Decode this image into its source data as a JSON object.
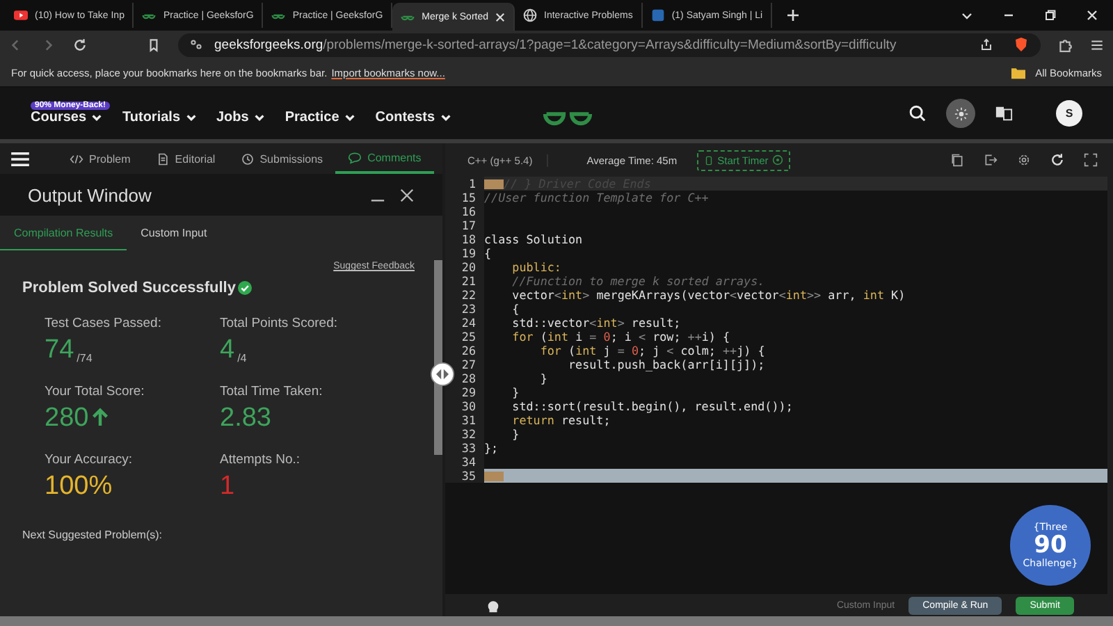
{
  "browser": {
    "tabs": [
      {
        "title": "(10) How to Take Inp",
        "kind": "video",
        "selected": false
      },
      {
        "title": "Practice | GeeksforG",
        "kind": "gfg",
        "selected": false
      },
      {
        "title": "Practice | GeeksforG",
        "kind": "gfg",
        "selected": false
      },
      {
        "title": "Merge k Sorted",
        "kind": "gfg",
        "selected": true
      },
      {
        "title": "Interactive Problems",
        "kind": "globe",
        "selected": false
      },
      {
        "title": "(1) Satyam Singh | Li",
        "kind": "square",
        "selected": false
      }
    ],
    "address": {
      "domain": "geeksforgeeks.org",
      "path": "/problems/merge-k-sorted-arrays/1?page=1&category=Arrays&difficulty=Medium&sortBy=difficulty"
    },
    "bookmarks": {
      "message": "For quick access, place your bookmarks here on the bookmarks bar.",
      "link": "Import bookmarks now...",
      "all": "All Bookmarks"
    }
  },
  "site_nav": {
    "badge": "90% Money-Back!",
    "items": [
      "Courses",
      "Tutorials",
      "Jobs",
      "Practice",
      "Contests"
    ],
    "avatar": "S"
  },
  "problem_tabs": [
    {
      "label": "Problem",
      "kind": "code",
      "selected": false
    },
    {
      "label": "Editorial",
      "kind": "doc",
      "selected": false
    },
    {
      "label": "Submissions",
      "kind": "clock",
      "selected": false
    },
    {
      "label": "Comments",
      "kind": "chat",
      "selected": true
    }
  ],
  "output_window": {
    "title": "Output Window",
    "tabs": [
      {
        "label": "Compilation Results",
        "selected": true
      },
      {
        "label": "Custom Input",
        "selected": false
      }
    ],
    "suggest_feedback": "Suggest Feedback",
    "status": "Problem Solved Successfully",
    "stats": [
      {
        "label": "Test Cases Passed:",
        "value": "74",
        "suffix": "/74",
        "color": "#3ea55c"
      },
      {
        "label": "Total Points Scored:",
        "value": "4",
        "suffix": "/4",
        "color": "#3ea55c"
      },
      {
        "label": "Your Total Score:",
        "value": "280",
        "arrow": true,
        "color": "#3ea55c"
      },
      {
        "label": "Total Time Taken:",
        "value": "2.83",
        "color": "#3ea55c"
      },
      {
        "label": "Your Accuracy:",
        "value": "100%",
        "color": "#e5b52c"
      },
      {
        "label": "Attempts No.:",
        "value": "1",
        "color": "#d42a2a"
      }
    ],
    "next_label": "Next Suggested Problem(s):"
  },
  "editor": {
    "language": "C++ (g++ 5.4)",
    "average_time": "Average Time: 45m",
    "timer": "Start Timer",
    "lines": [
      {
        "number": "1",
        "folded": true,
        "selected": false,
        "segs": [
          {
            "kind": "dim",
            "t": "// } Driver Code Ends"
          }
        ]
      },
      {
        "number": "15",
        "folded": false,
        "selected": false,
        "segs": [
          {
            "kind": "cm",
            "t": "//User function Template for C++"
          }
        ]
      },
      {
        "number": "16",
        "folded": false,
        "selected": false
      },
      {
        "number": "17",
        "folded": false,
        "selected": false
      },
      {
        "number": "18",
        "folded": false,
        "selected": false,
        "segs": [
          {
            "kind": "p",
            "t": "class Solution"
          }
        ]
      },
      {
        "number": "19",
        "folded": false,
        "selected": false,
        "segs": [
          {
            "kind": "p",
            "t": "{"
          }
        ]
      },
      {
        "number": "20",
        "folded": false,
        "selected": false,
        "segs": [
          {
            "kind": "kw",
            "t": "    public:"
          }
        ]
      },
      {
        "number": "21",
        "folded": false,
        "selected": false,
        "segs": [
          {
            "kind": "cm",
            "t": "    //Function to merge k sorted arrays."
          }
        ]
      },
      {
        "number": "22",
        "folded": false,
        "selected": false,
        "segs": [
          {
            "kind": "p",
            "t": "    vector"
          },
          {
            "kind": "op",
            "t": "<"
          },
          {
            "kind": "kw",
            "t": "int"
          },
          {
            "kind": "op",
            "t": ">"
          },
          {
            "kind": "p",
            "t": " mergeKArrays(vector"
          },
          {
            "kind": "op",
            "t": "<"
          },
          {
            "kind": "p",
            "t": "vector"
          },
          {
            "kind": "op",
            "t": "<"
          },
          {
            "kind": "kw",
            "t": "int"
          },
          {
            "kind": "op",
            "t": ">>"
          },
          {
            "kind": "p",
            "t": " arr, "
          },
          {
            "kind": "kw",
            "t": "int"
          },
          {
            "kind": "p",
            "t": " K)"
          }
        ]
      },
      {
        "number": "23",
        "folded": false,
        "selected": false,
        "segs": [
          {
            "kind": "p",
            "t": "    {"
          }
        ]
      },
      {
        "number": "24",
        "folded": false,
        "selected": false,
        "segs": [
          {
            "kind": "p",
            "t": "    std::vector"
          },
          {
            "kind": "op",
            "t": "<"
          },
          {
            "kind": "kw",
            "t": "int"
          },
          {
            "kind": "op",
            "t": ">"
          },
          {
            "kind": "p",
            "t": " result;"
          }
        ]
      },
      {
        "number": "25",
        "folded": false,
        "selected": false,
        "segs": [
          {
            "kind": "kw",
            "t": "    for"
          },
          {
            "kind": "p",
            "t": " ("
          },
          {
            "kind": "kw",
            "t": "int"
          },
          {
            "kind": "p",
            "t": " i "
          },
          {
            "kind": "op",
            "t": "= "
          },
          {
            "kind": "num",
            "t": "0"
          },
          {
            "kind": "p",
            "t": "; i "
          },
          {
            "kind": "op",
            "t": "<"
          },
          {
            "kind": "p",
            "t": " row; "
          },
          {
            "kind": "op",
            "t": "++"
          },
          {
            "kind": "p",
            "t": "i) {"
          }
        ]
      },
      {
        "number": "26",
        "folded": false,
        "selected": false,
        "segs": [
          {
            "kind": "kw",
            "t": "        for"
          },
          {
            "kind": "p",
            "t": " ("
          },
          {
            "kind": "kw",
            "t": "int"
          },
          {
            "kind": "p",
            "t": " j "
          },
          {
            "kind": "op",
            "t": "= "
          },
          {
            "kind": "num",
            "t": "0"
          },
          {
            "kind": "p",
            "t": "; j "
          },
          {
            "kind": "op",
            "t": "<"
          },
          {
            "kind": "p",
            "t": " colm; "
          },
          {
            "kind": "op",
            "t": "++"
          },
          {
            "kind": "p",
            "t": "j) {"
          }
        ]
      },
      {
        "number": "27",
        "folded": false,
        "selected": false,
        "segs": [
          {
            "kind": "p",
            "t": "            result.push_back(arr[i][j]);"
          }
        ]
      },
      {
        "number": "28",
        "folded": false,
        "selected": false,
        "segs": [
          {
            "kind": "p",
            "t": "        }"
          }
        ]
      },
      {
        "number": "29",
        "folded": false,
        "selected": false,
        "segs": [
          {
            "kind": "p",
            "t": "    }"
          }
        ]
      },
      {
        "number": "30",
        "folded": false,
        "selected": false,
        "segs": [
          {
            "kind": "p",
            "t": "    std::sort(result.begin(), result.end());"
          }
        ]
      },
      {
        "number": "31",
        "folded": false,
        "selected": false,
        "segs": [
          {
            "kind": "kw",
            "t": "    return"
          },
          {
            "kind": "p",
            "t": " result;"
          }
        ]
      },
      {
        "number": "32",
        "folded": false,
        "selected": false,
        "segs": [
          {
            "kind": "p",
            "t": "    }"
          }
        ]
      },
      {
        "number": "33",
        "folded": false,
        "selected": false,
        "segs": [
          {
            "kind": "p",
            "t": "};"
          }
        ]
      },
      {
        "number": "34",
        "folded": false,
        "selected": false
      },
      {
        "number": "35",
        "folded": true,
        "selected": true
      }
    ],
    "challenge": {
      "top": "{Three",
      "number": "90",
      "bottom": "Challenge}"
    },
    "custom_input": "Custom Input",
    "compile": "Compile & Run",
    "submit": "Submit"
  }
}
